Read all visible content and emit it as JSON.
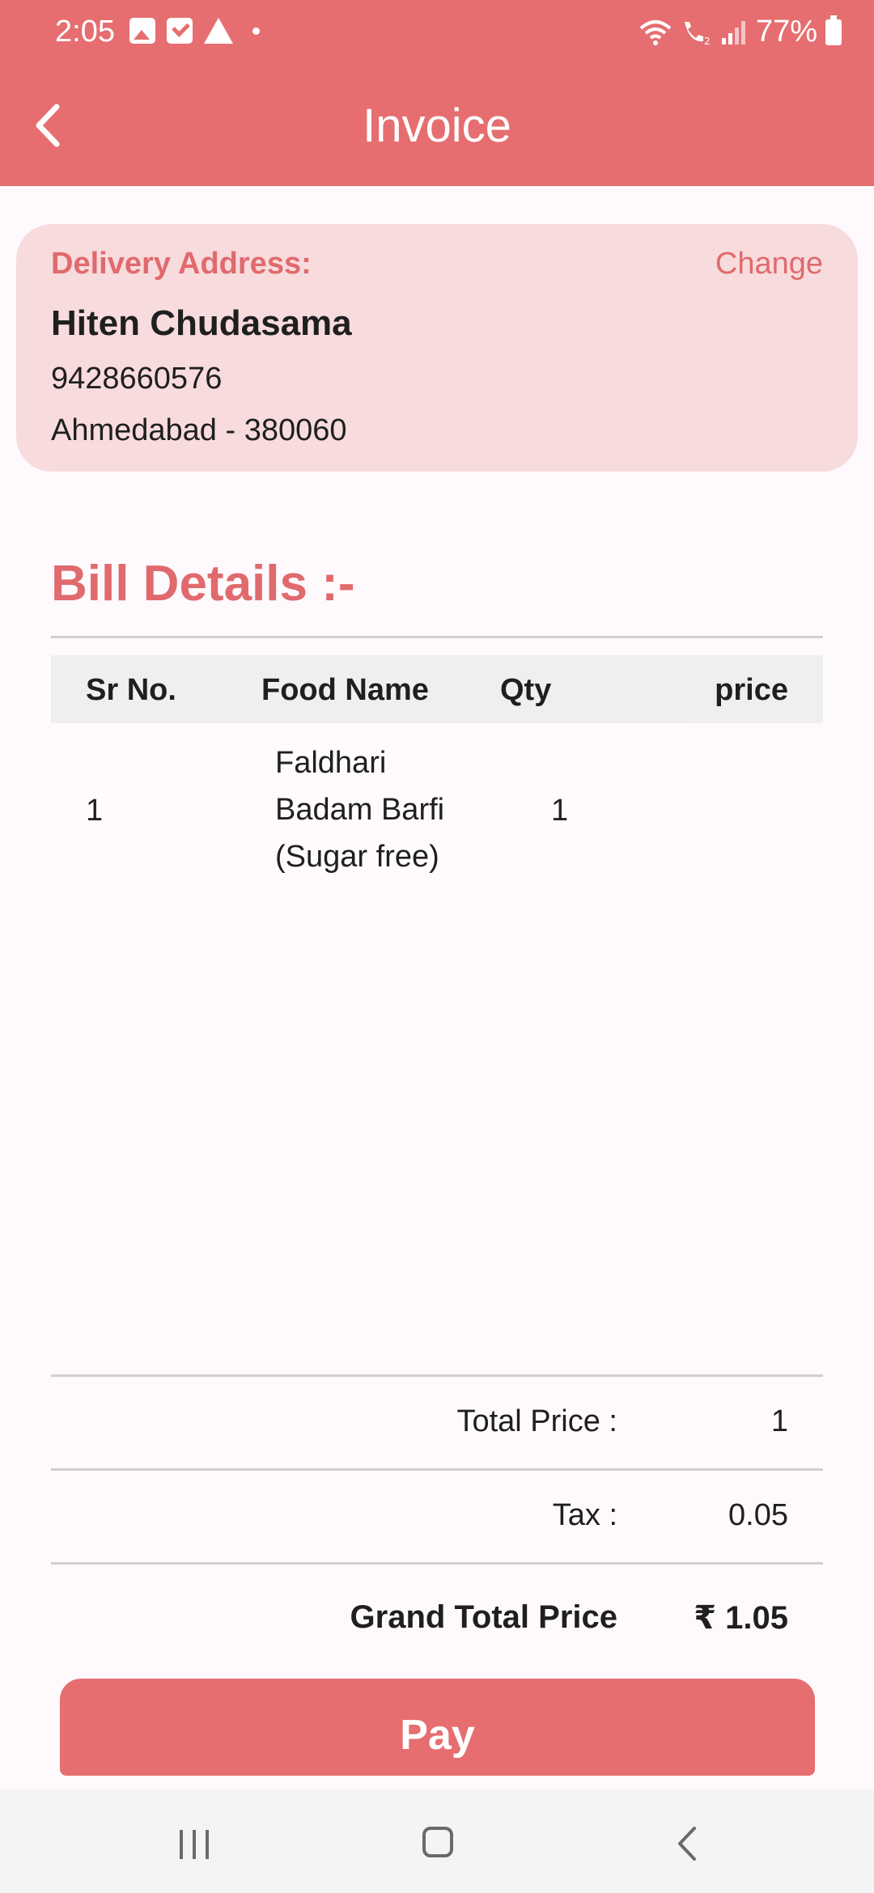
{
  "status_bar": {
    "time": "2:05",
    "battery": "77%"
  },
  "header": {
    "title": "Invoice"
  },
  "address": {
    "label": "Delivery Address:",
    "change_label": "Change",
    "name": "Hiten Chudasama",
    "phone": "9428660576",
    "city": "Ahmedabad - 380060"
  },
  "bill": {
    "title": "Bill Details :-",
    "columns": [
      "Sr No.",
      "Food Name",
      "Qty",
      "price"
    ],
    "rows": [
      {
        "sr": "1",
        "food_lines": [
          "Faldhari",
          "Badam Barfi",
          "(Sugar free)"
        ],
        "qty": "1",
        "price": ""
      }
    ]
  },
  "summary": {
    "total_label": "Total Price :",
    "total_value": "1",
    "tax_label": "Tax :",
    "tax_value": "0.05",
    "grand_label": "Grand Total Price",
    "grand_value": "₹ 1.05"
  },
  "pay_label": "Pay",
  "colors": {
    "accent": "#e66e70",
    "card": "#f8dbdd",
    "accent_text": "#e06a6d"
  }
}
